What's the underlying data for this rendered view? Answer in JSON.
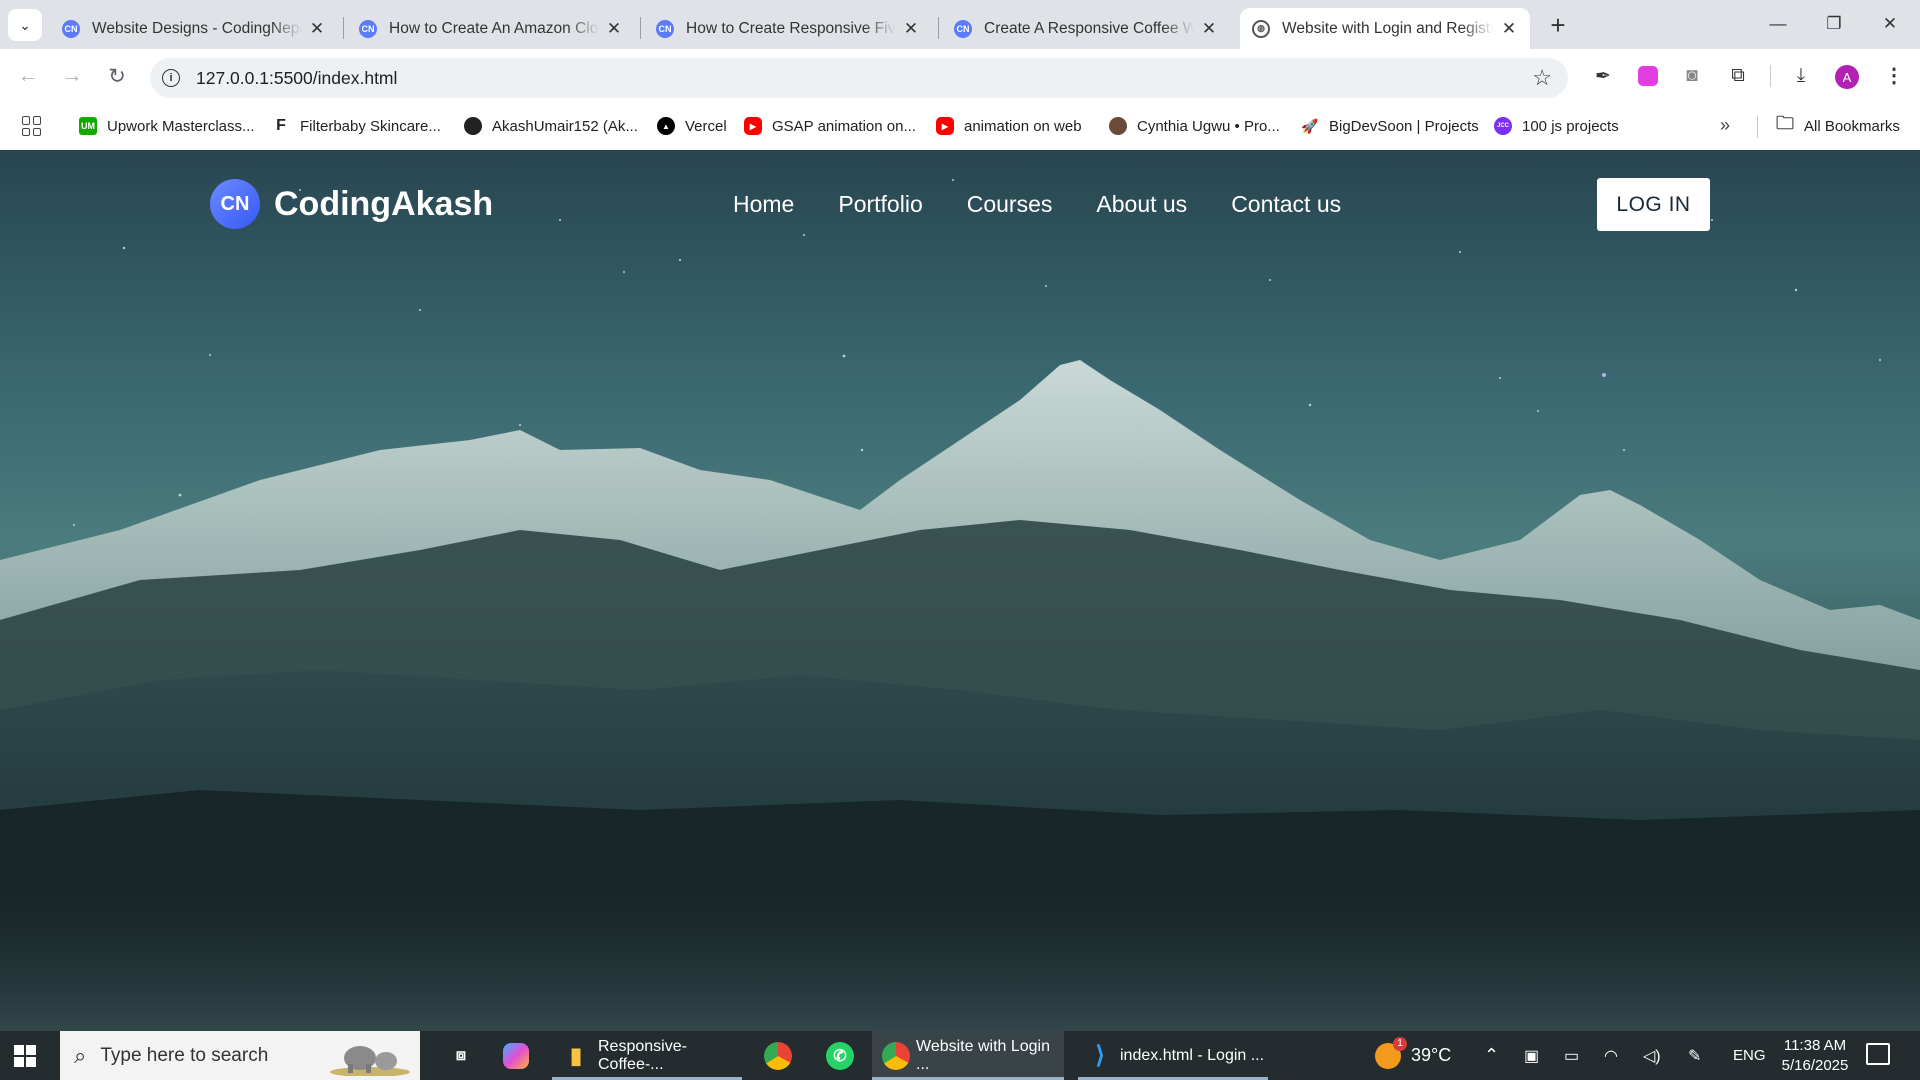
{
  "browser": {
    "tabs": [
      {
        "title": "Website Designs - CodingNepal",
        "favicon": "codingnepal-logo-icon"
      },
      {
        "title": "How to Create An Amazon Clone",
        "favicon": "codingnepal-logo-icon"
      },
      {
        "title": "How to Create Responsive Fiverr",
        "favicon": "codingnepal-logo-icon"
      },
      {
        "title": "Create A Responsive Coffee Website",
        "favicon": "codingnepal-logo-icon"
      },
      {
        "title": "Website with Login and Registration",
        "favicon": "globe-icon",
        "active": true
      }
    ],
    "favicon_text": "CN",
    "url": "127.0.0.1:5500/index.html",
    "profile_initial": "A",
    "bookmarks": [
      {
        "label": "Upwork Masterclass...",
        "icon_text": "UM",
        "color": "#14a800"
      },
      {
        "label": "Filterbaby Skincare...",
        "icon_text": "F",
        "color": "#222222"
      },
      {
        "label": "AkashUmair152 (Ak...",
        "icon_text": "",
        "color": "#222222"
      },
      {
        "label": "Vercel",
        "icon_text": "▲",
        "color": "#000000"
      },
      {
        "label": "GSAP animation on...",
        "icon_text": "▶",
        "color": "#ff0000"
      },
      {
        "label": "animation on web",
        "icon_text": "▶",
        "color": "#ff0000"
      },
      {
        "label": "Cynthia Ugwu • Pro...",
        "icon_text": "",
        "color": "#6b4a3a"
      },
      {
        "label": "BigDevSoon | Projects",
        "icon_text": "🚀",
        "color": "#ffffff"
      },
      {
        "label": "100 js projects",
        "icon_text": "JCC",
        "color": "#7b2ff7"
      }
    ],
    "all_bookmarks_label": "All Bookmarks"
  },
  "site": {
    "logo_mark": "CN",
    "brand": "CodingAkash",
    "nav": [
      "Home",
      "Portfolio",
      "Courses",
      "About us",
      "Contact us"
    ],
    "login_label": "LOG IN"
  },
  "taskbar": {
    "search_placeholder": "Type here to search",
    "apps": [
      {
        "label": "Responsive-Coffee-...",
        "icon": "file-explorer-icon"
      },
      {
        "label": "Website with Login ...",
        "icon": "chrome-icon"
      },
      {
        "label": "index.html - Login ...",
        "icon": "vscode-icon"
      }
    ],
    "weather": "39°C",
    "weather_badge": "1",
    "language": "ENG",
    "time": "11:38 AM",
    "date": "5/16/2025"
  },
  "colors": {
    "accent": "#4a6cf7",
    "tabstrip": "#dfe3e8",
    "taskbar": "#242c30"
  }
}
